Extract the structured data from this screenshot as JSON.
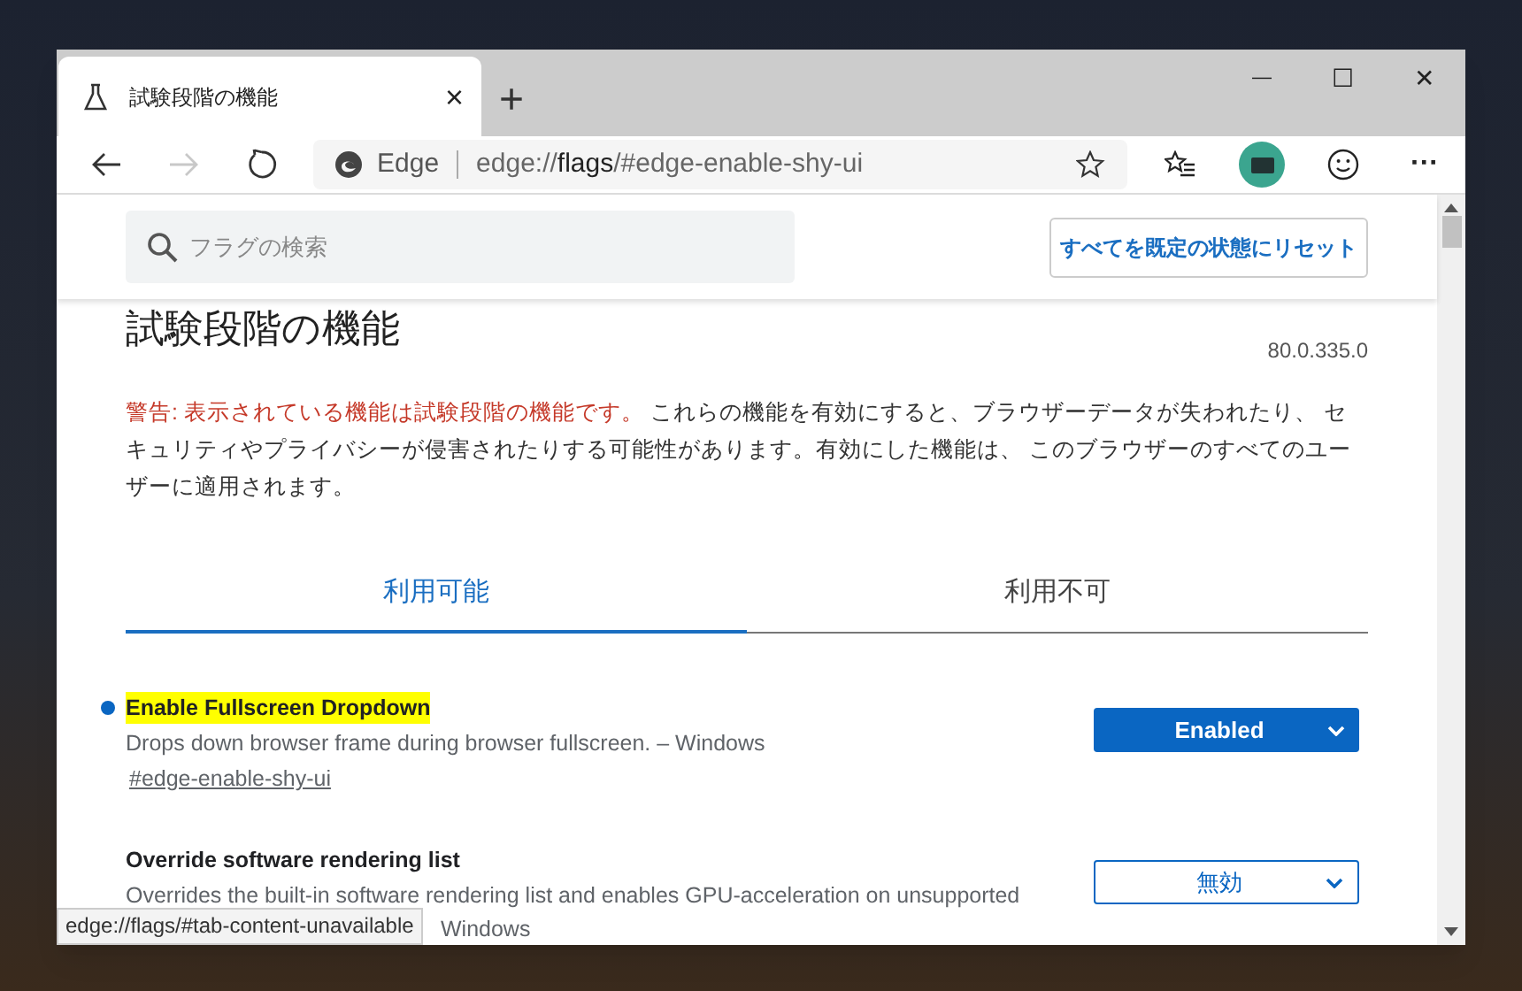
{
  "tab": {
    "title": "試験段階の機能",
    "close": "×",
    "new_tab": "+"
  },
  "window_controls": {
    "minimize": "—",
    "maximize": "☐",
    "close": "✕"
  },
  "toolbar": {
    "back_disabled": false,
    "forward_disabled": true,
    "site_label": "Edge",
    "url_prefix": "edge://",
    "url_host": "flags",
    "url_rest": "/#edge-enable-shy-ui",
    "more": "···"
  },
  "header": {
    "search_placeholder": "フラグの検索",
    "reset_button": "すべてを既定の状態にリセット"
  },
  "page": {
    "title": "試験段階の機能",
    "version": "80.0.335.0",
    "warning": "警告: 表示されている機能は試験段階の機能です。",
    "warning_rest": " これらの機能を有効にすると、ブラウザーデータが失われたり、 セキュリティやプライバシーが侵害されたりする可能性があります。有効にした機能は、 このブラウザーのすべてのユーザーに適用されます。"
  },
  "tabs": [
    {
      "label": "利用可能",
      "selected": true
    },
    {
      "label": "利用不可",
      "selected": false
    }
  ],
  "flags": [
    {
      "name": "Enable Fullscreen Dropdown",
      "modified": true,
      "highlighted": true,
      "description": "Drops down browser frame during browser fullscreen. – Windows",
      "link": "#edge-enable-shy-ui",
      "value": "Enabled",
      "active": true
    },
    {
      "name": "Override software rendering list",
      "modified": false,
      "highlighted": false,
      "description": "Overrides the built-in software rendering list and enables GPU-acceleration on unsupported",
      "description_tail": "Windows",
      "value": "無効",
      "active": false
    }
  ],
  "status_bubble": "edge://flags/#tab-content-unavailable"
}
